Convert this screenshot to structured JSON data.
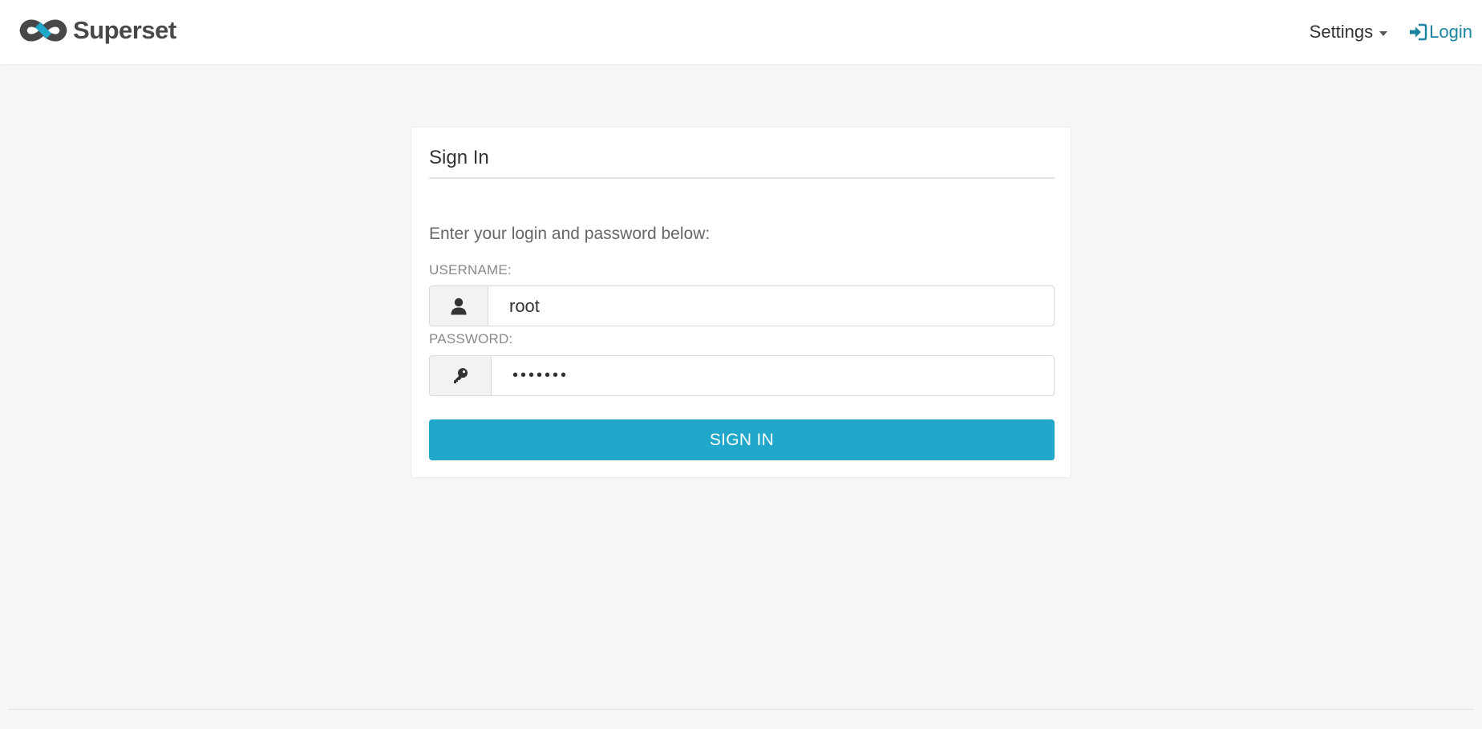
{
  "colors": {
    "accent": "#20a7c9",
    "link": "#1a85a0",
    "logo_dark": "#484848",
    "logo_blue": "#20a7c9",
    "page_background": "#f6f6f6"
  },
  "navbar": {
    "brand_name": "Superset",
    "brand_icon": "superset-infinity-logo",
    "settings_label": "Settings",
    "settings_icon": "caret-down-icon",
    "login_label": "Login",
    "login_icon": "sign-in-icon"
  },
  "login_form": {
    "title": "Sign In",
    "instruction": "Enter your login and password below:",
    "username_label": "USERNAME:",
    "username_icon": "user-icon",
    "username_value": "root",
    "password_label": "PASSWORD:",
    "password_icon": "key-icon",
    "password_value": "•••••••",
    "submit_label": "SIGN IN"
  }
}
